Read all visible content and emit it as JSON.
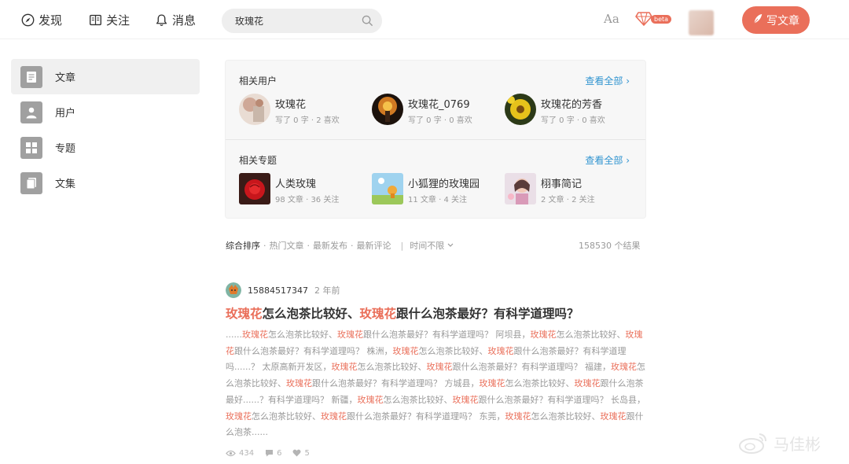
{
  "nav": {
    "discover": "发现",
    "follow": "关注",
    "messages": "消息",
    "search_value": "玫瑰花",
    "font_toggle": "Aa",
    "beta_badge": "beta",
    "write_button": "写文章"
  },
  "sidebar": {
    "items": [
      {
        "label": "文章"
      },
      {
        "label": "用户"
      },
      {
        "label": "专题"
      },
      {
        "label": "文集"
      }
    ]
  },
  "related_users": {
    "title": "相关用户",
    "see_all": "查看全部 ›",
    "items": [
      {
        "name": "玫瑰花",
        "meta": "写了 0 字 · 2 喜欢"
      },
      {
        "name": "玫瑰花_0769",
        "meta": "写了 0 字 · 0 喜欢"
      },
      {
        "name": "玫瑰花的芳香",
        "meta": "写了 0 字 · 0 喜欢"
      }
    ]
  },
  "related_topics": {
    "title": "相关专题",
    "see_all": "查看全部 ›",
    "items": [
      {
        "name": "人类玫瑰",
        "meta": "98 文章 · 36 关注"
      },
      {
        "name": "小狐狸的玫瑰园",
        "meta": "11 文章 · 4 关注"
      },
      {
        "name": "栩事简记",
        "meta": "2 文章 · 2 关注"
      }
    ]
  },
  "sort": {
    "active": "综合排序",
    "options": [
      "热门文章",
      "最新发布",
      "最新评论"
    ],
    "time": "时间不限",
    "results": "158530 个结果"
  },
  "article": {
    "author": "15884517347",
    "time": "2 年前",
    "title_hl_1": "玫瑰花",
    "title_mid": "怎么泡茶比较好、",
    "title_hl_2": "玫瑰花",
    "title_end": "跟什么泡茶最好？有科学道理吗？",
    "abstract": [
      {
        "t": "......",
        "h": false
      },
      {
        "t": "玫瑰花",
        "h": true
      },
      {
        "t": "怎么泡茶比较好、",
        "h": false
      },
      {
        "t": "玫瑰花",
        "h": true
      },
      {
        "t": "跟什么泡茶最好？有科学道理吗？ 阿坝县，",
        "h": false
      },
      {
        "t": "玫瑰花",
        "h": true
      },
      {
        "t": "怎么泡茶比较好、",
        "h": false
      },
      {
        "t": "玫瑰花",
        "h": true
      },
      {
        "t": "跟什么泡茶最好？有科学道理吗？ 株洲，",
        "h": false
      },
      {
        "t": "玫瑰花",
        "h": true
      },
      {
        "t": "怎么泡茶比较好、",
        "h": false
      },
      {
        "t": "玫瑰花",
        "h": true
      },
      {
        "t": "跟什么泡茶最好？有科学道理吗......？ 太原高新开发区，",
        "h": false
      },
      {
        "t": "玫瑰花",
        "h": true
      },
      {
        "t": "怎么泡茶比较好、",
        "h": false
      },
      {
        "t": "玫瑰花",
        "h": true
      },
      {
        "t": "跟什么泡茶最好？有科学道理吗？ 福建，",
        "h": false
      },
      {
        "t": "玫瑰花",
        "h": true
      },
      {
        "t": "怎么泡茶比较好、",
        "h": false
      },
      {
        "t": "玫瑰花",
        "h": true
      },
      {
        "t": "跟什么泡茶最好？有科学道理吗？ 方城县，",
        "h": false
      },
      {
        "t": "玫瑰花",
        "h": true
      },
      {
        "t": "怎么泡茶比较好、",
        "h": false
      },
      {
        "t": "玫瑰花",
        "h": true
      },
      {
        "t": "跟什么泡茶最好......？有科学道理吗？ 新疆，",
        "h": false
      },
      {
        "t": "玫瑰花",
        "h": true
      },
      {
        "t": "怎么泡茶比较好、",
        "h": false
      },
      {
        "t": "玫瑰花",
        "h": true
      },
      {
        "t": "跟什么泡茶最好？有科学道理吗？ 长岛县，",
        "h": false
      },
      {
        "t": "玫瑰花",
        "h": true
      },
      {
        "t": "怎么泡茶比较好、",
        "h": false
      },
      {
        "t": "玫瑰花",
        "h": true
      },
      {
        "t": "跟什么泡茶最好？有科学道理吗？ 东莞，",
        "h": false
      },
      {
        "t": "玫瑰花",
        "h": true
      },
      {
        "t": "怎么泡茶比较好、",
        "h": false
      },
      {
        "t": "玫瑰花",
        "h": true
      },
      {
        "t": "跟什么泡茶......",
        "h": false
      }
    ],
    "views": "434",
    "comments": "6",
    "likes": "5"
  },
  "watermark": "马佳彬",
  "colors": {
    "accent": "#ea6f5a",
    "link": "#3194d0",
    "muted": "#999999"
  }
}
